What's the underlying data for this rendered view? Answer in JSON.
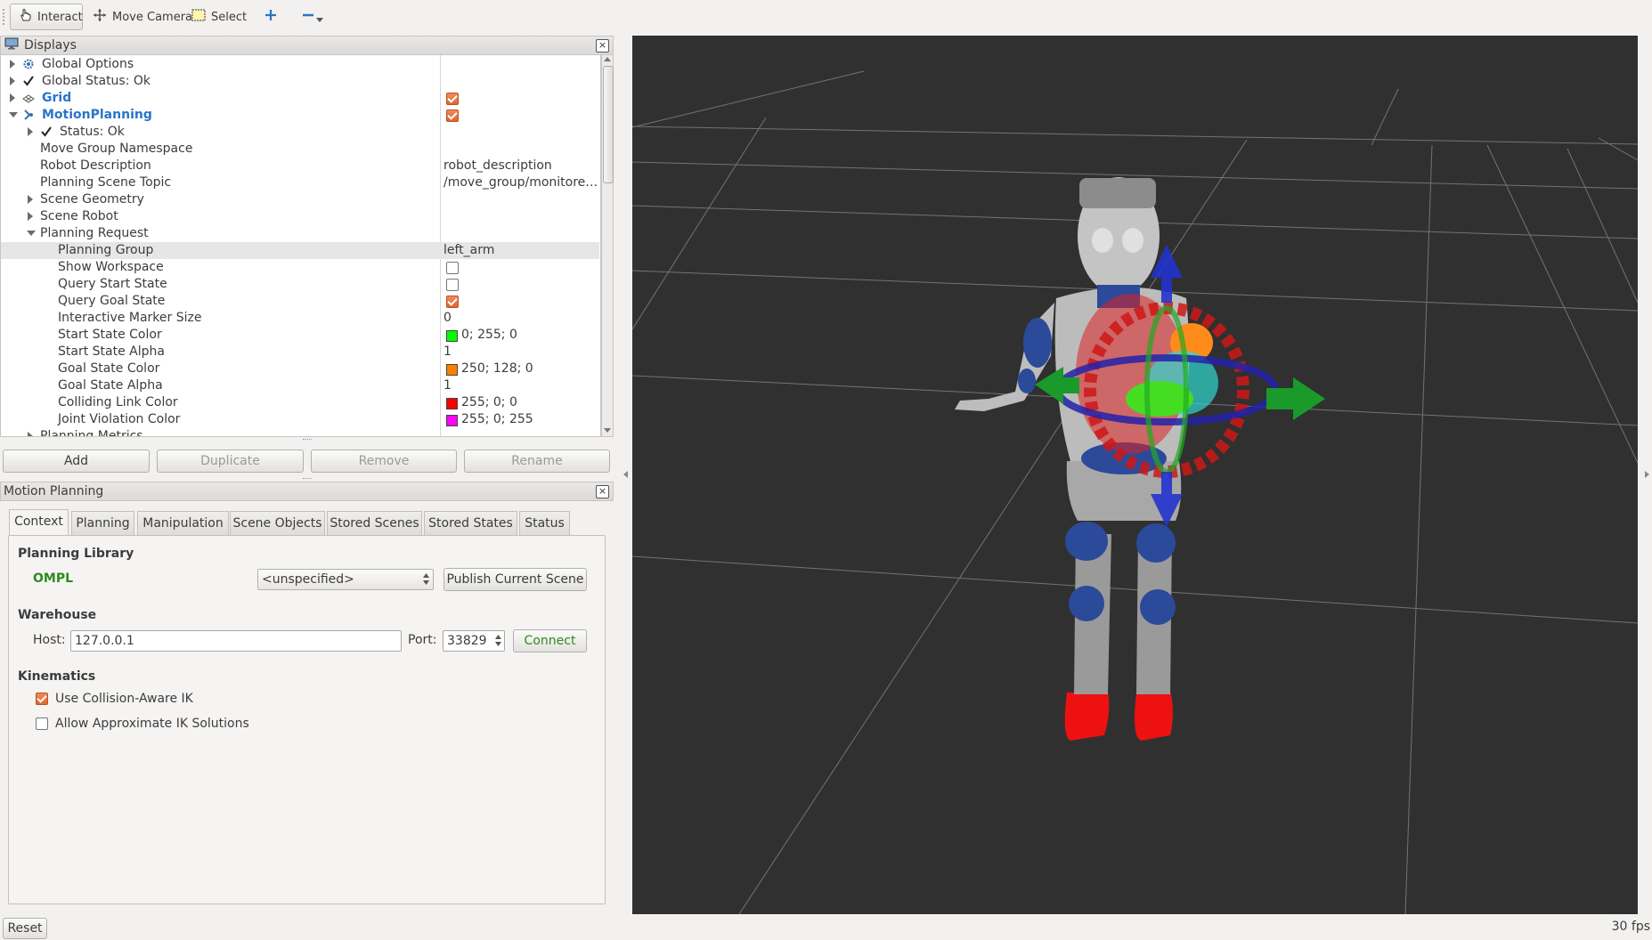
{
  "toolbar": {
    "interact": "Interact",
    "move_camera": "Move Camera",
    "select": "Select"
  },
  "displays_panel": {
    "title": "Displays",
    "rows": [
      {
        "name": "Global Options",
        "value": ""
      },
      {
        "name": "Global Status: Ok",
        "value": ""
      },
      {
        "name": "Grid",
        "value": ""
      },
      {
        "name": "MotionPlanning",
        "value": ""
      },
      {
        "name": "Status: Ok",
        "value": ""
      },
      {
        "name": "Move Group Namespace",
        "value": ""
      },
      {
        "name": "Robot Description",
        "value": "robot_description"
      },
      {
        "name": "Planning Scene Topic",
        "value": "/move_group/monitore…"
      },
      {
        "name": "Scene Geometry",
        "value": ""
      },
      {
        "name": "Scene Robot",
        "value": ""
      },
      {
        "name": "Planning Request",
        "value": ""
      },
      {
        "name": "Planning Group",
        "value": "left_arm"
      },
      {
        "name": "Show Workspace",
        "value": ""
      },
      {
        "name": "Query Start State",
        "value": ""
      },
      {
        "name": "Query Goal State",
        "value": ""
      },
      {
        "name": "Interactive Marker Size",
        "value": "0"
      },
      {
        "name": "Start State Color",
        "value": "0; 255; 0"
      },
      {
        "name": "Start State Alpha",
        "value": "1"
      },
      {
        "name": "Goal State Color",
        "value": "250; 128; 0"
      },
      {
        "name": "Goal State Alpha",
        "value": "1"
      },
      {
        "name": "Colliding Link Color",
        "value": "255; 0; 0"
      },
      {
        "name": "Joint Violation Color",
        "value": "255; 0; 255"
      },
      {
        "name": "Planning Metrics",
        "value": ""
      }
    ],
    "checkboxes": {
      "grid": true,
      "motion_planning": true,
      "show_workspace": false,
      "query_start_state": false,
      "query_goal_state": true
    },
    "colors": {
      "start_state": "#00ff00",
      "goal_state": "#fa8000",
      "colliding_link": "#ff0000",
      "joint_violation": "#ff00ff"
    },
    "buttons": {
      "add": "Add",
      "duplicate": "Duplicate",
      "remove": "Remove",
      "rename": "Rename"
    }
  },
  "motion_panel": {
    "title": "Motion Planning",
    "tabs": [
      "Context",
      "Planning",
      "Manipulation",
      "Scene Objects",
      "Stored Scenes",
      "Stored States",
      "Status"
    ],
    "active_tab": "Context",
    "planning_library_label": "Planning Library",
    "library_name": "OMPL",
    "planner_select": "<unspecified>",
    "publish_button": "Publish Current Scene",
    "warehouse_label": "Warehouse",
    "host_label": "Host:",
    "host_value": "127.0.0.1",
    "port_label": "Port:",
    "port_value": "33829",
    "connect_button": "Connect",
    "kinematics_label": "Kinematics",
    "collision_aware_ik": "Use Collision-Aware IK",
    "collision_aware_ik_checked": true,
    "approx_ik": "Allow Approximate IK Solutions",
    "approx_ik_checked": false
  },
  "status_bar": {
    "reset": "Reset",
    "fps": "30 fps"
  },
  "theme": {
    "accent_blue": "#2a74c8",
    "ompl_green": "#2e8b1e",
    "viewport_bg": "#303030"
  }
}
